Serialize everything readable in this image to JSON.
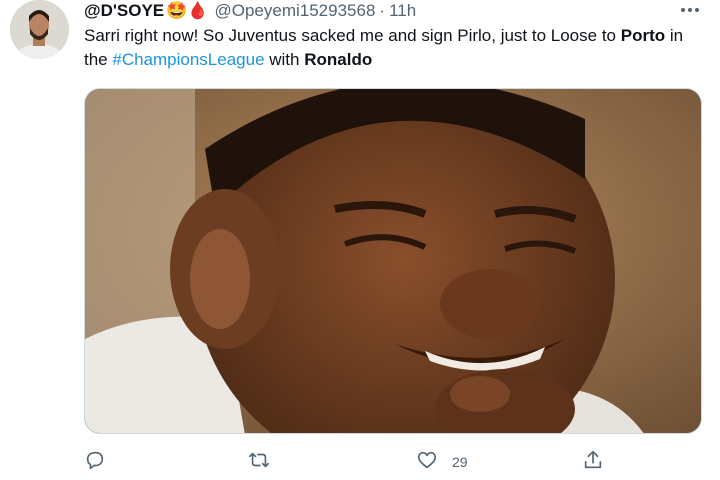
{
  "tweet": {
    "display_name": "@D'SOYE",
    "name_emojis": "🤩🩸",
    "handle": "@Opeyemi15293568",
    "separator": "·",
    "time": "11h",
    "text": {
      "part1": "Sarri right now! So Juventus sacked me and sign Pirlo, just to Loose to ",
      "bold1": "Porto",
      "part2": " in the ",
      "hashtag": "#ChampionsLeague",
      "part3": " with ",
      "bold2": "Ronaldo"
    },
    "more_icon": "more-horizontal-icon",
    "media_alt": "photo"
  },
  "actions": {
    "reply_icon": "reply-icon",
    "retweet_icon": "retweet-icon",
    "like_icon": "heart-icon",
    "like_count": "29",
    "share_icon": "share-icon"
  },
  "colors": {
    "text": "#0f1419",
    "secondary": "#536471",
    "link": "#1b95e0"
  }
}
